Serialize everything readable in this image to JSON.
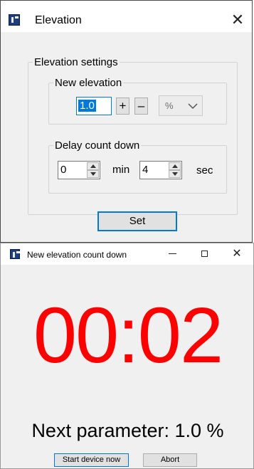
{
  "elevation_window": {
    "title": "Elevation",
    "close_symbol": "✕",
    "settings_group": "Elevation settings",
    "new_elevation_group": "New elevation",
    "elevation_value": "1.0",
    "plus_label": "+",
    "minus_label": "–",
    "unit_value": "%",
    "delay_group": "Delay count down",
    "minutes_value": "0",
    "minutes_label": "min",
    "seconds_value": "4",
    "seconds_label": "sec",
    "set_label": "Set"
  },
  "countdown_window": {
    "title": "New elevation count down",
    "close_symbol": "✕",
    "countdown": "00:02",
    "countdown_color": "#ff0000",
    "next_parameter": "Next parameter: 1.0 %",
    "start_label": "Start device now",
    "abort_label": "Abort"
  },
  "colors": {
    "accent": "#0078d7",
    "dialog_bg": "#f0f0f0"
  }
}
